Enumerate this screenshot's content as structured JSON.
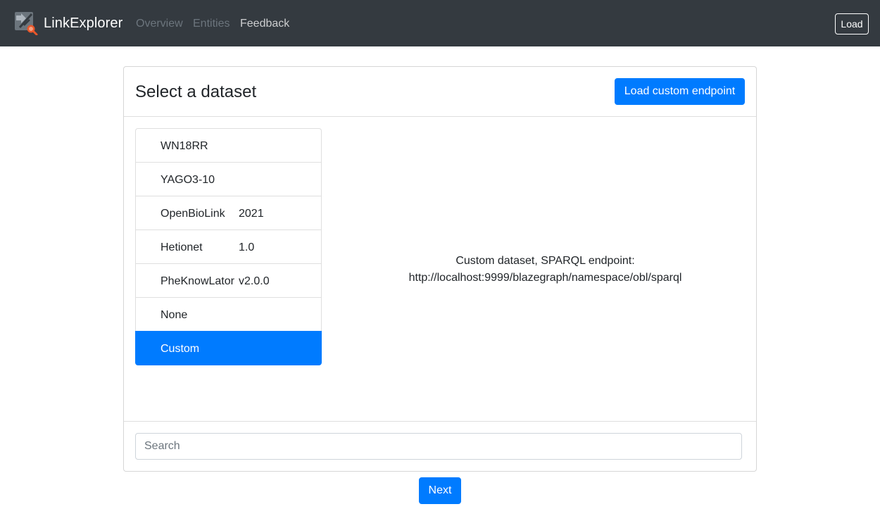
{
  "navbar": {
    "brand": "LinkExplorer",
    "logo_icon": "link-explorer-logo-icon",
    "links": [
      {
        "label": "Overview",
        "state": "disabled"
      },
      {
        "label": "Entities",
        "state": "disabled"
      },
      {
        "label": "Feedback",
        "state": "active"
      }
    ],
    "load_button": "Load",
    "background_color": "#343a40"
  },
  "card": {
    "title": "Select a dataset",
    "custom_endpoint_button": "Load custom endpoint",
    "datasets": [
      {
        "name": "WN18RR",
        "version": ""
      },
      {
        "name": "YAGO3-10",
        "version": ""
      },
      {
        "name": "OpenBioLink",
        "version": "2021"
      },
      {
        "name": "Hetionet",
        "version": "1.0"
      },
      {
        "name": "PheKnowLator",
        "version": "v2.0.0"
      },
      {
        "name": "None",
        "version": ""
      },
      {
        "name": "Custom",
        "version": "",
        "selected": true
      }
    ],
    "description": {
      "line1": "Custom dataset, SPARQL endpoint:",
      "line2": "http://localhost:9999/blazegraph/namespace/obl/sparql"
    },
    "search": {
      "placeholder": "Search",
      "value": ""
    }
  },
  "next_button": "Next",
  "colors": {
    "primary": "#007bff",
    "navbar": "#343a40"
  }
}
